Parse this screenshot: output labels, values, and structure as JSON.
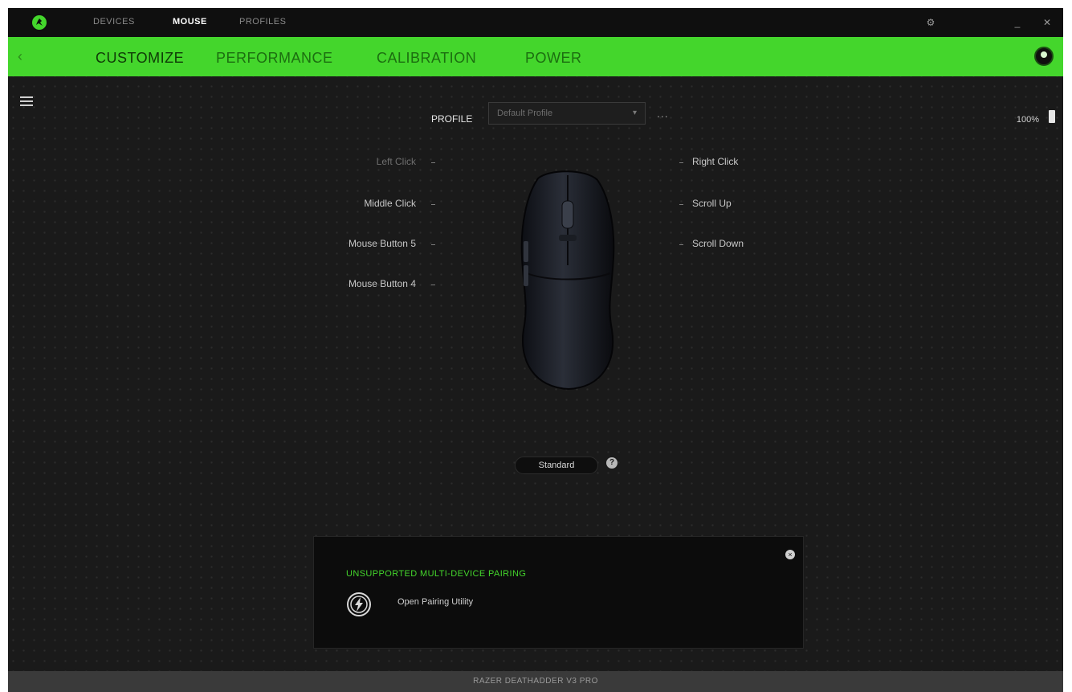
{
  "app": {
    "top_tabs": [
      "DEVICES",
      "MOUSE",
      "PROFILES"
    ],
    "active_top_tab": "MOUSE",
    "sub_tabs": [
      "CUSTOMIZE",
      "PERFORMANCE",
      "CALIBRATION",
      "POWER"
    ],
    "active_sub_tab": "CUSTOMIZE",
    "brand_color": "#44d62c"
  },
  "profile": {
    "label": "PROFILE",
    "selected": "Default Profile",
    "more": "..."
  },
  "battery": {
    "label": "100%",
    "level": 1.0
  },
  "buttons": {
    "left": [
      "Left Click",
      "Middle Click",
      "Mouse Button 5",
      "Mouse Button 4"
    ],
    "right": [
      "Right Click",
      "Scroll Up",
      "Scroll Down"
    ]
  },
  "mode": {
    "label": "Standard",
    "help": "?"
  },
  "card": {
    "title": "UNSUPPORTED MULTI-DEVICE PAIRING",
    "link": "Open Pairing Utility",
    "close": "×"
  },
  "status": {
    "device_name": "RAZER DEATHADDER V3 PRO"
  },
  "icons": {
    "logo": "razer-logo-icon",
    "settings": "gear-icon",
    "minimize": "minimize-icon",
    "close": "close-icon",
    "back": "back-arrow-icon",
    "menu": "hamburger-menu-icon",
    "battery": "battery-icon",
    "pairing": "lightning-pairing-icon"
  }
}
